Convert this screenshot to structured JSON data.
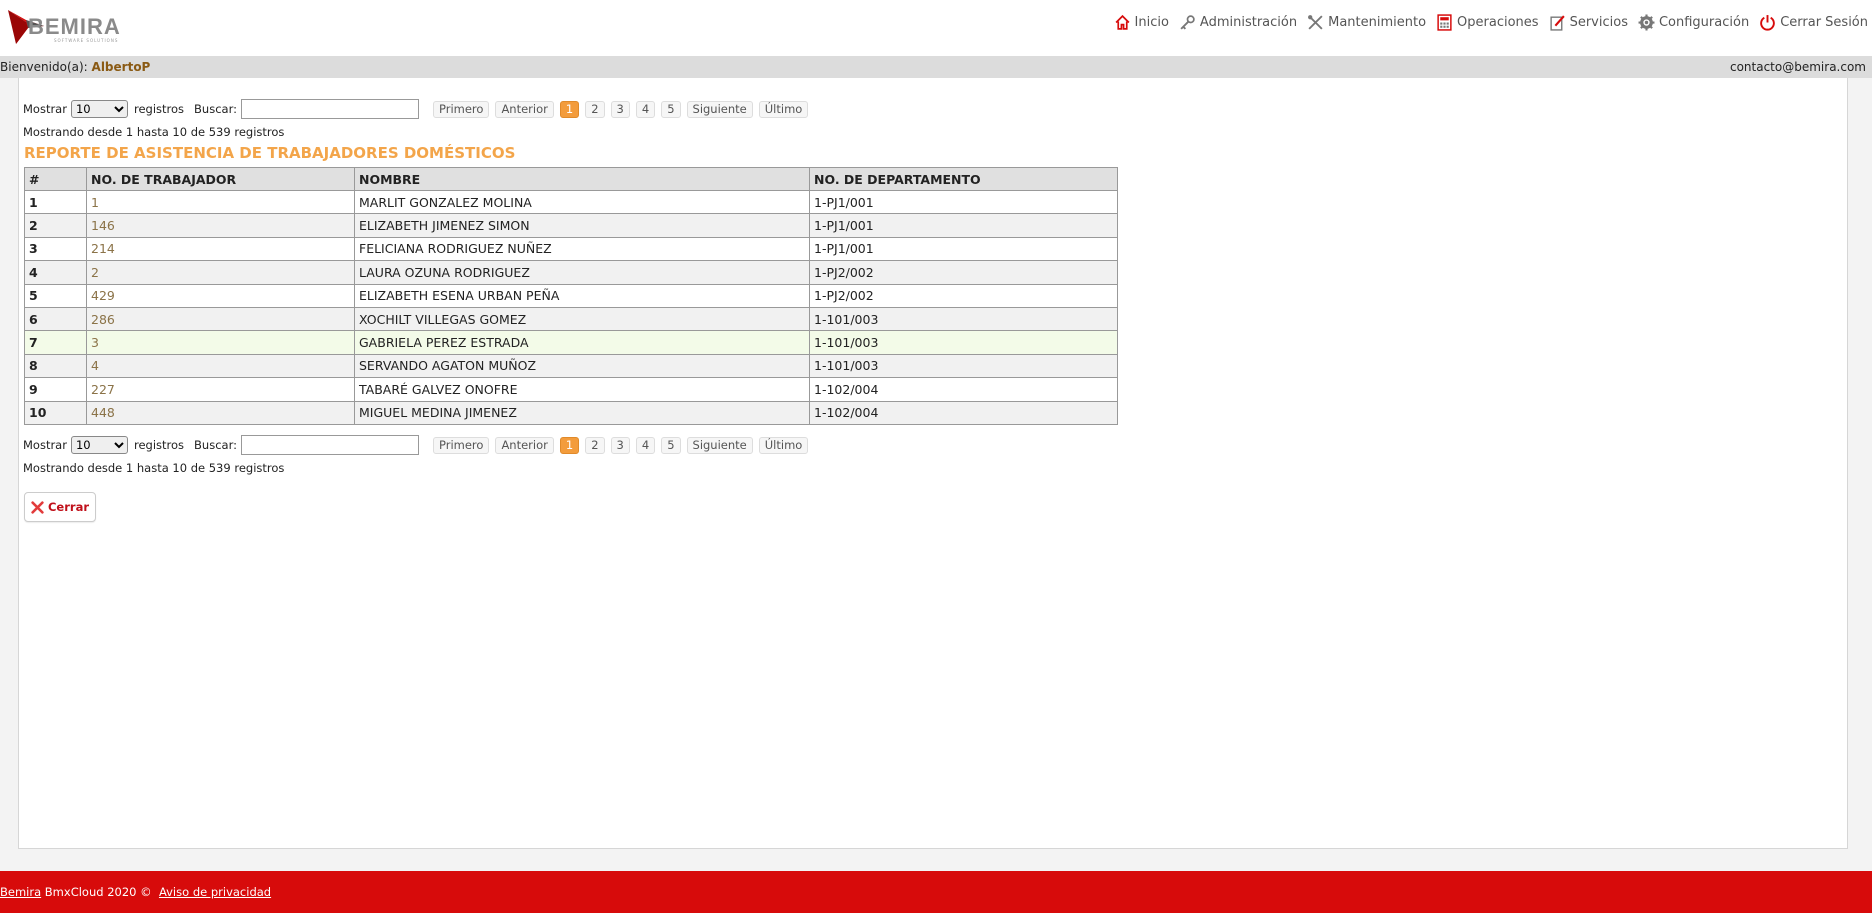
{
  "brand": {
    "name": "BEMIRA",
    "tagline": "SOFTWARE SOLUTIONS",
    "accent": "#d70b0b"
  },
  "nav": [
    {
      "label": "Inicio",
      "icon": "home-icon"
    },
    {
      "label": "Administración",
      "icon": "key-icon"
    },
    {
      "label": "Mantenimiento",
      "icon": "tools-icon"
    },
    {
      "label": "Operaciones",
      "icon": "calculator-icon"
    },
    {
      "label": "Servicios",
      "icon": "edit-icon"
    },
    {
      "label": "Configuración",
      "icon": "gear-icon"
    },
    {
      "label": "Cerrar Sesión",
      "icon": "power-icon"
    }
  ],
  "userbar": {
    "welcome_label": "Bienvenido(a):",
    "user": "AlbertoP",
    "contact": "contacto@bemira.com"
  },
  "controls": {
    "show_label": "Mostrar",
    "show_value": "10",
    "records_label": "registros",
    "search_label": "Buscar:",
    "search_value": "",
    "first": "Primero",
    "previous": "Anterior",
    "pages": [
      "1",
      "2",
      "3",
      "4",
      "5"
    ],
    "current_page": "1",
    "next": "Siguiente",
    "last": "Último",
    "info": "Mostrando desde 1 hasta 10 de 539 registros"
  },
  "report": {
    "title": "REPORTE DE ASISTENCIA DE TRABAJADORES DOMÉSTICOS",
    "columns": [
      "#",
      "NO. DE TRABAJADOR",
      "NOMBRE",
      "NO. DE DEPARTAMENTO"
    ],
    "rows": [
      [
        "1",
        "1",
        "MARLIT GONZALEZ MOLINA",
        "1-PJ1/001"
      ],
      [
        "2",
        "146",
        "ELIZABETH JIMENEZ SIMON",
        "1-PJ1/001"
      ],
      [
        "3",
        "214",
        "FELICIANA RODRIGUEZ NUÑEZ",
        "1-PJ1/001"
      ],
      [
        "4",
        "2",
        "LAURA OZUNA RODRIGUEZ",
        "1-PJ2/002"
      ],
      [
        "5",
        "429",
        "ELIZABETH ESENA URBAN PEÑA",
        "1-PJ2/002"
      ],
      [
        "6",
        "286",
        "XOCHILT VILLEGAS GOMEZ",
        "1-101/003"
      ],
      [
        "7",
        "3",
        "GABRIELA PEREZ ESTRADA",
        "1-101/003"
      ],
      [
        "8",
        "4",
        "SERVANDO AGATON MUÑOZ",
        "1-101/003"
      ],
      [
        "9",
        "227",
        "TABARÉ GALVEZ ONOFRE",
        "1-102/004"
      ],
      [
        "10",
        "448",
        "MIGUEL MEDINA JIMENEZ",
        "1-102/004"
      ]
    ],
    "highlighted_row": 7
  },
  "close_label": "Cerrar",
  "footer": {
    "brand_link": "Bemira",
    "text": "BmxCloud 2020 ©",
    "privacy": "Aviso de privacidad"
  }
}
